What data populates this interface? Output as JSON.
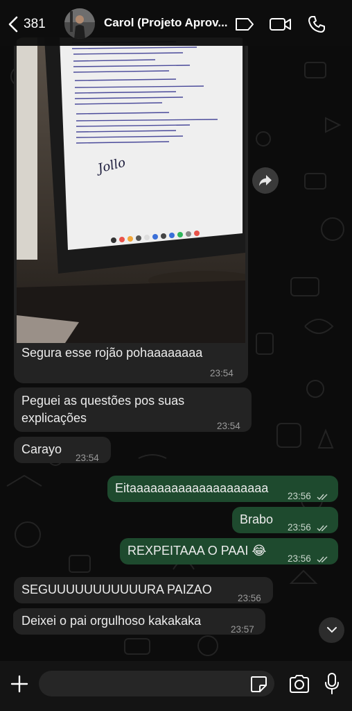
{
  "header": {
    "back_count": "381",
    "contact_name": "Carol (Projeto Aprov..."
  },
  "messages": {
    "photo": {
      "caption": "Segura esse rojão pohaaaaaaaa",
      "time": "23:54",
      "handwriting": "Jollo"
    },
    "m1": {
      "line1": "Peguei as questões pos suas",
      "line2": "explicações",
      "time": "23:54"
    },
    "m2": {
      "text": "Carayo",
      "time": "23:54"
    },
    "m3": {
      "text": "Eitaaaaaaaaaaaaaaaaaaaa",
      "time": "23:56"
    },
    "m4": {
      "text": "Brabo",
      "time": "23:56"
    },
    "m5": {
      "text": "REXPEITAAA O PAAI 😂",
      "time": "23:56"
    },
    "m6": {
      "text": "SEGUUUUUUUUUUURA PAIZAO",
      "time": "23:56"
    },
    "m7": {
      "text": "Deixei o pai orgulhoso kakakaka",
      "time": "23:57"
    }
  },
  "composer": {
    "placeholder": "",
    "value": ""
  },
  "colors": {
    "incoming_bubble": "#232323",
    "outgoing_bubble": "#1e4a2e",
    "read_ticks": "#c9d6cc"
  },
  "icons": [
    "chevron-left-icon",
    "tag-icon",
    "video-call-icon",
    "phone-icon",
    "forward-icon",
    "chevron-down-icon",
    "plus-icon",
    "sticker-icon",
    "camera-icon",
    "mic-icon"
  ]
}
